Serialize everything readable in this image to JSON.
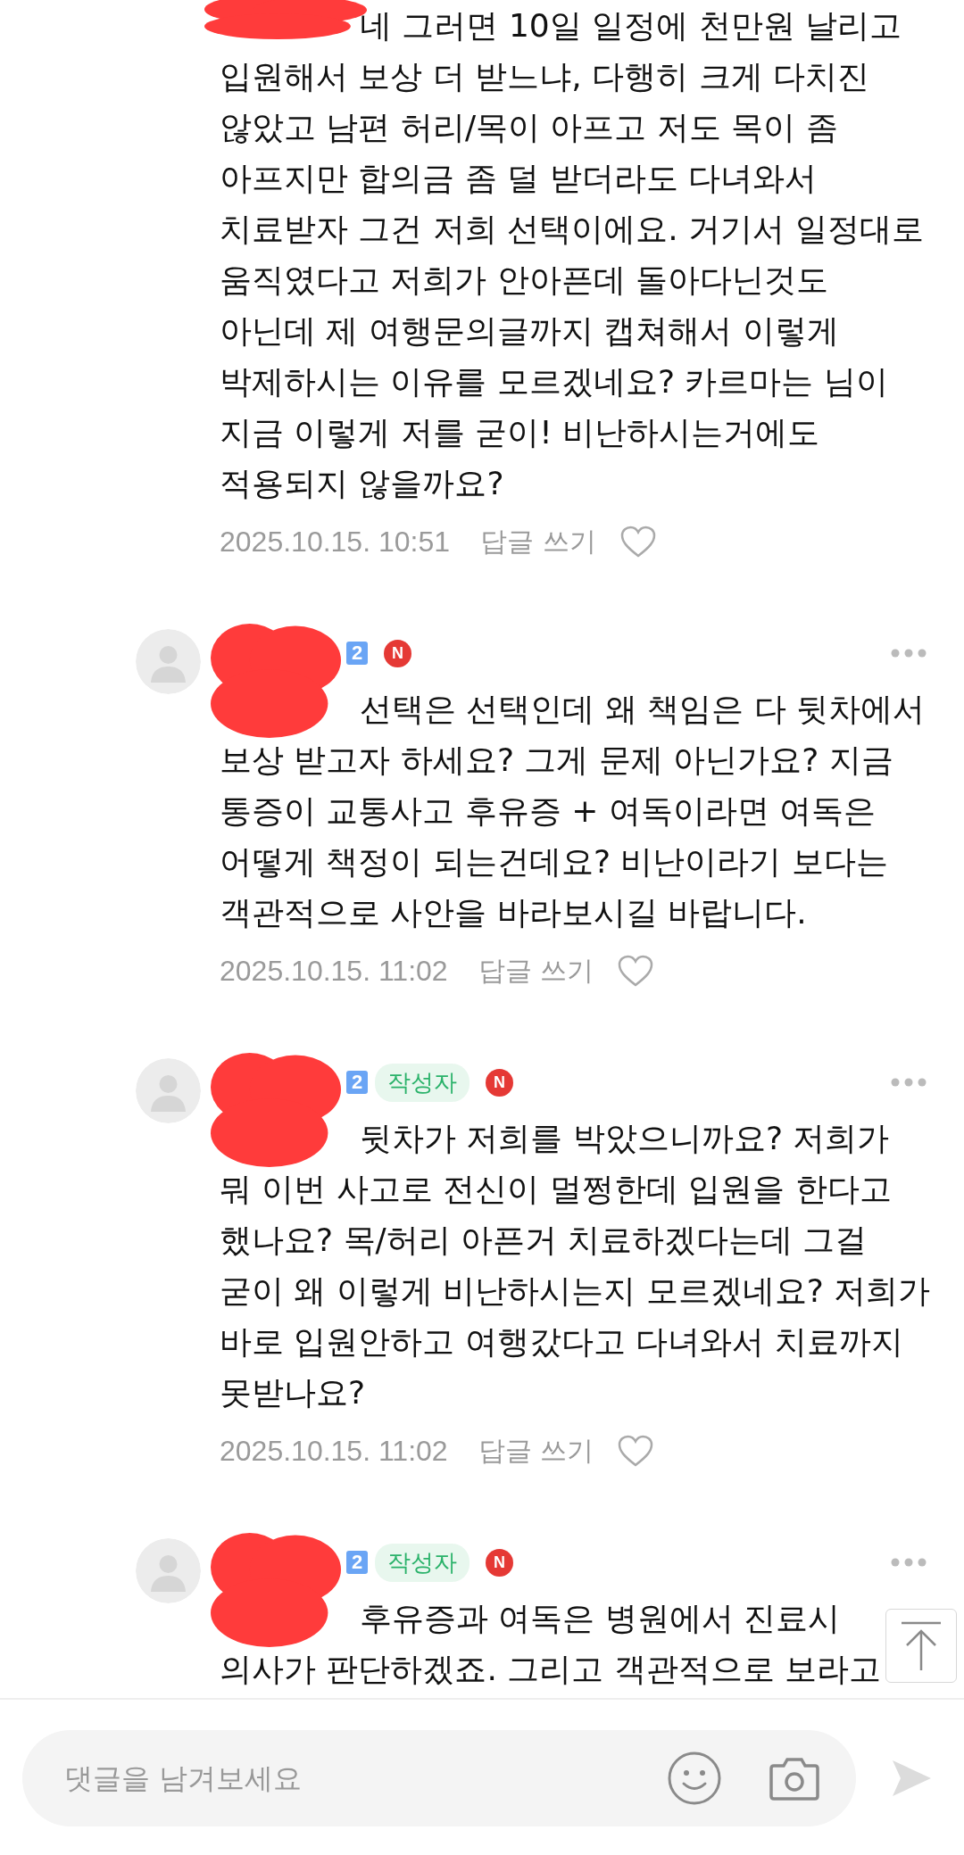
{
  "comments": [
    {
      "mention_redacted": true,
      "text": "네 그러면 10일 일정에 천만원 날리고\n입원해서 보상 더 받느냐, 다행히 크게 다치진\n않았고 남편 허리/목이 아프고 저도 목이 좀\n아프지만 합의금 좀 덜 받더라도 다녀와서\n치료받자 그건 저희 선택이에요. 거기서 일정대로\n움직였다고 저희가 안아픈데 돌아다닌것도\n아닌데 제 여행문의글까지 캡쳐해서 이렇게\n박제하시는 이유를 모르겠네요? 카르마는 님이\n지금 이렇게 저를 굳이! 비난하시는거에도\n적용되지 않을까요?",
      "date": "2025.10.15. 10:51",
      "reply": "답글 쓰기",
      "liked": false
    },
    {
      "header": {
        "level_badge": "2",
        "new_badge": "N"
      },
      "mention_redacted": true,
      "text": "선택은 선택인데 왜 책임은 다 뒷차에서\n보상 받고자 하세요? 그게 문제 아닌가요? 지금\n통증이 교통사고 후유증 + 여독이라면 여독은\n어떻게 책정이 되는건데요? 비난이라기 보다는\n객관적으로 사안을 바라보시길 바랍니다.",
      "date": "2025.10.15. 11:02",
      "reply": "답글 쓰기",
      "liked": false
    },
    {
      "header": {
        "level_badge": "2",
        "author_tag": "작성자",
        "new_badge": "N"
      },
      "mention_redacted": true,
      "text": "뒷차가 저희를 박았으니까요? 저희가\n뭐 이번 사고로 전신이 멀쩡한데 입원을 한다고\n했나요? 목/허리 아픈거 치료하겠다는데 그걸\n굳이 왜 이렇게 비난하시는지 모르겠네요? 저희가\n바로 입원안하고 여행갔다고 다녀와서 치료까지\n못받나요?",
      "date": "2025.10.15. 11:02",
      "reply": "답글 쓰기",
      "liked": false
    },
    {
      "header": {
        "level_badge": "2",
        "author_tag": "작성자",
        "new_badge": "N"
      },
      "mention_redacted": true,
      "text": "후유증과 여독은 병원에서 진료시\n의사가 판단하겠죠. 그리고 객관적으로 보라고"
    }
  ],
  "comment_input": {
    "placeholder": "댓글을 남겨보세요"
  }
}
